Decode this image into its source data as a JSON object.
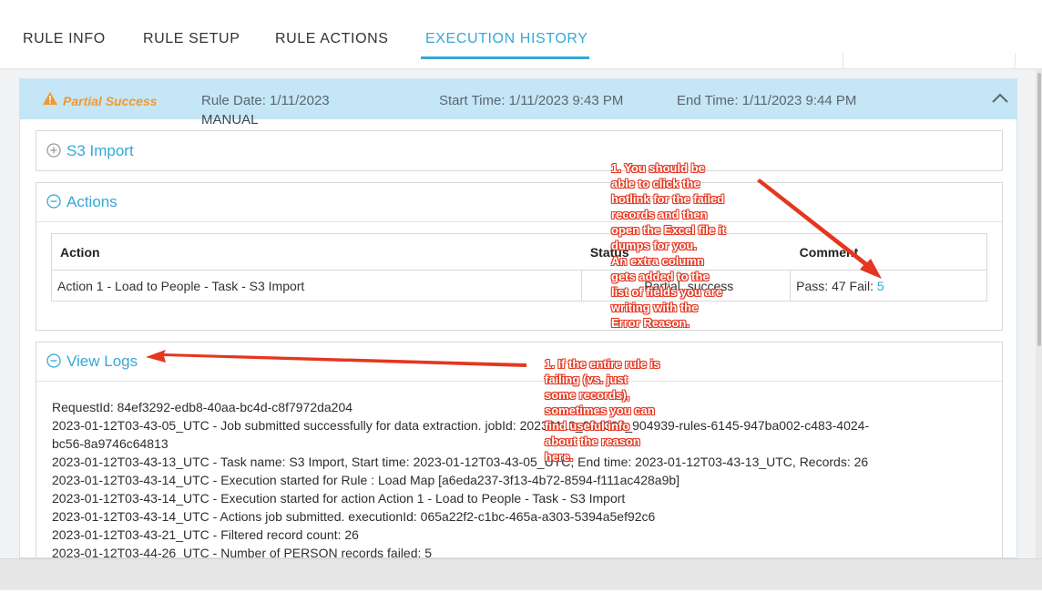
{
  "tabs": [
    {
      "label": "RULE INFO",
      "active": false
    },
    {
      "label": "RULE SETUP",
      "active": false
    },
    {
      "label": "RULE ACTIONS",
      "active": false
    },
    {
      "label": "EXECUTION HISTORY",
      "active": true
    }
  ],
  "execution": {
    "status": "Partial Success",
    "rule_date": "Rule Date: 1/11/2023",
    "trigger": "MANUAL",
    "start_time": "Start Time: 1/11/2023 9:43 PM",
    "end_time": "End Time: 1/11/2023 9:44 PM"
  },
  "sections": {
    "s3_import": {
      "title": "S3 Import",
      "state": "collapsed"
    },
    "actions": {
      "title": "Actions",
      "state": "expanded"
    },
    "view_logs": {
      "title": "View Logs",
      "state": "expanded"
    }
  },
  "actions_table": {
    "headers": [
      "Action",
      "Status",
      "Comment"
    ],
    "rows": [
      {
        "action": "Action 1 - Load to People - Task - S3 Import",
        "status": "Partial_success",
        "comment_prefix": "Pass: 47 Fail: ",
        "fail_link": "5"
      }
    ]
  },
  "logs": [
    "RequestId: 84ef3292-edb8-40aa-bc4d-c8f7972da204",
    "2023-01-12T03-43-05_UTC - Job submitted successfully for data extraction. jobId: 20230112_034305_904939-rules-6145-947ba002-c483-4024-",
    "bc56-8a9746c64813",
    "2023-01-12T03-43-13_UTC - Task name: S3 Import, Start time: 2023-01-12T03-43-05_UTC, End time: 2023-01-12T03-43-13_UTC, Records: 26",
    "2023-01-12T03-43-14_UTC - Execution started for Rule : Load Map [a6eda237-3f13-4b72-8594-f111ac428a9b]",
    "2023-01-12T03-43-14_UTC - Execution started for action Action 1 - Load to People - Task - S3 Import",
    "2023-01-12T03-43-14_UTC - Actions job submitted. executionId: 065a22f2-c1bc-465a-a303-5394a5ef92c6",
    "2023-01-12T03-43-21_UTC - Filtered record count: 26",
    "2023-01-12T03-44-26_UTC - Number of PERSON records failed: 5"
  ],
  "annotations": {
    "failed_records": "1. You should be\nable to click the\nhotlink for the failed\nrecords and then\nopen the Excel file it\ndumps for you.\nAn extra column\ngets added to the\nlist of fields you are\nwriting with the\nError Reason.",
    "logs_note": "1. If the entire rule is\nfailing (vs. just\nsome records),\nsometimes you can\nfind useful info\nabout the reason\nhere."
  },
  "colors": {
    "accent": "#36a8d6",
    "header_bg": "#c4e6f6",
    "warning": "#f5982b",
    "annotation_red": "#e5361f"
  },
  "icons": {
    "status": "warning-triangle-icon",
    "collapse": "chevron-up-icon",
    "expand": "plus-circle-icon",
    "collapse_section": "minus-circle-icon"
  }
}
